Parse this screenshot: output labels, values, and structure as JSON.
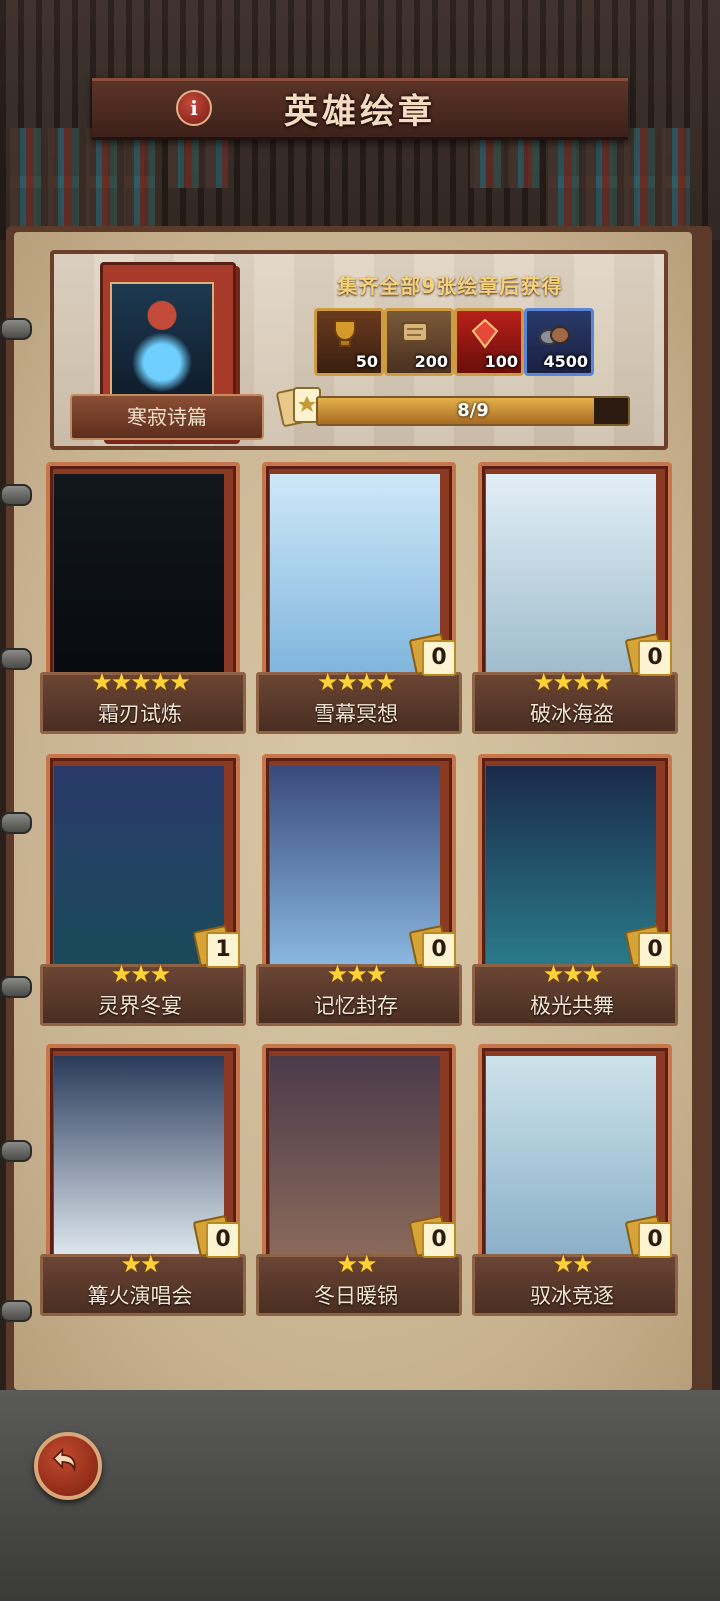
{
  "header": {
    "title": "英雄绘章",
    "info_label": "i"
  },
  "album": {
    "name": "寒寂诗篇",
    "reward_title": "集齐全部9张绘章后获得",
    "rewards": [
      {
        "icon": "gold-trophy-icon",
        "qty": "50",
        "color": "#d49a2a"
      },
      {
        "icon": "scroll-icon",
        "qty": "200",
        "color": "#c9a05a"
      },
      {
        "icon": "red-gem-icon",
        "qty": "100",
        "color": "#d9342a"
      },
      {
        "icon": "ore-pile-icon",
        "qty": "4500",
        "color": "#6a6f7a"
      }
    ],
    "progress_text": "8/9",
    "progress_fraction": 0.889
  },
  "cards": [
    {
      "name": "霜刃试炼",
      "stars": "★★★★★",
      "count": null,
      "locked": true
    },
    {
      "name": "雪幕冥想",
      "stars": "★★★★",
      "count": "0",
      "locked": false
    },
    {
      "name": "破冰海盗",
      "stars": "★★★★",
      "count": "0",
      "locked": false
    },
    {
      "name": "灵界冬宴",
      "stars": "★★★",
      "count": "1",
      "locked": false
    },
    {
      "name": "记忆封存",
      "stars": "★★★",
      "count": "0",
      "locked": false
    },
    {
      "name": "极光共舞",
      "stars": "★★★",
      "count": "0",
      "locked": false
    },
    {
      "name": "篝火演唱会",
      "stars": "★★",
      "count": "0",
      "locked": false
    },
    {
      "name": "冬日暖锅",
      "stars": "★★",
      "count": "0",
      "locked": false
    },
    {
      "name": "驭冰竞逐",
      "stars": "★★",
      "count": "0",
      "locked": false
    }
  ],
  "footer": {
    "back_icon": "return-arrow-icon"
  }
}
